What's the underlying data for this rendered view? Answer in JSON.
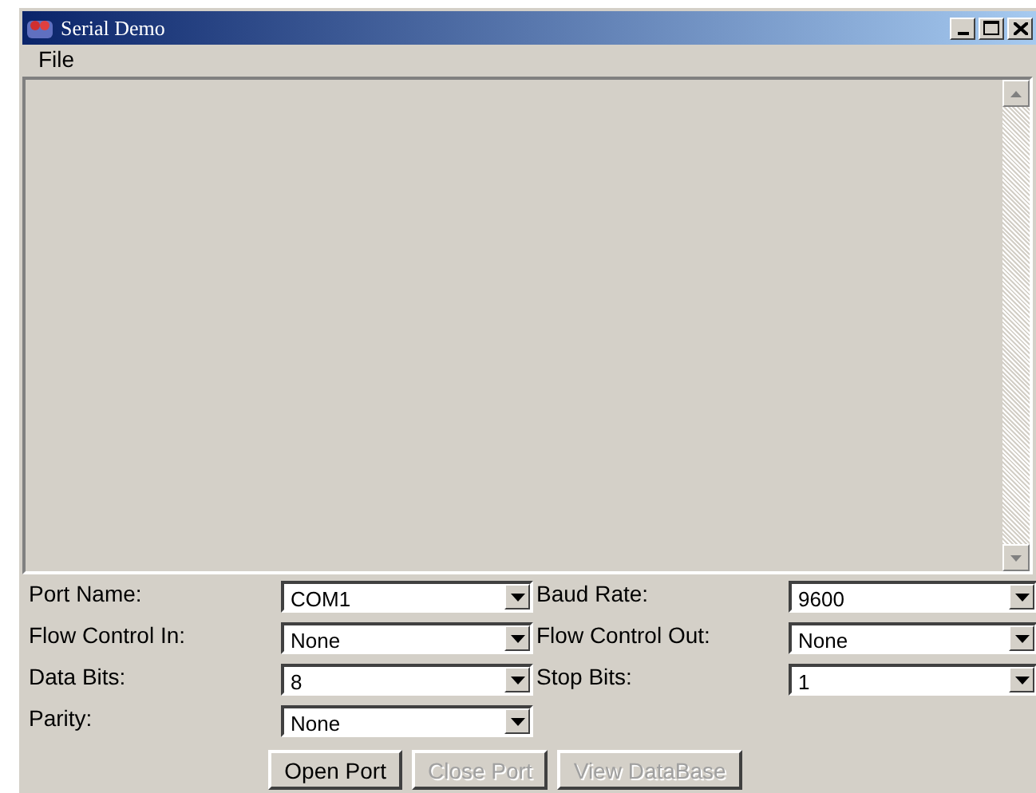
{
  "window": {
    "title": "Serial Demo"
  },
  "menu": [
    "File"
  ],
  "settings": [
    {
      "label": "Port Name:",
      "value": "COM1"
    },
    {
      "label": "Baud Rate:",
      "value": "9600"
    },
    {
      "label": "Flow Control In:",
      "value": "None"
    },
    {
      "label": "Flow Control Out:",
      "value": "None"
    },
    {
      "label": "Data Bits:",
      "value": "8"
    },
    {
      "label": "Stop Bits:",
      "value": "1"
    },
    {
      "label": "Parity:",
      "value": "None"
    }
  ],
  "buttons": [
    {
      "label": "Open Port",
      "disabled": false
    },
    {
      "label": "Close Port",
      "disabled": true
    },
    {
      "label": "View DataBase",
      "disabled": true
    }
  ]
}
